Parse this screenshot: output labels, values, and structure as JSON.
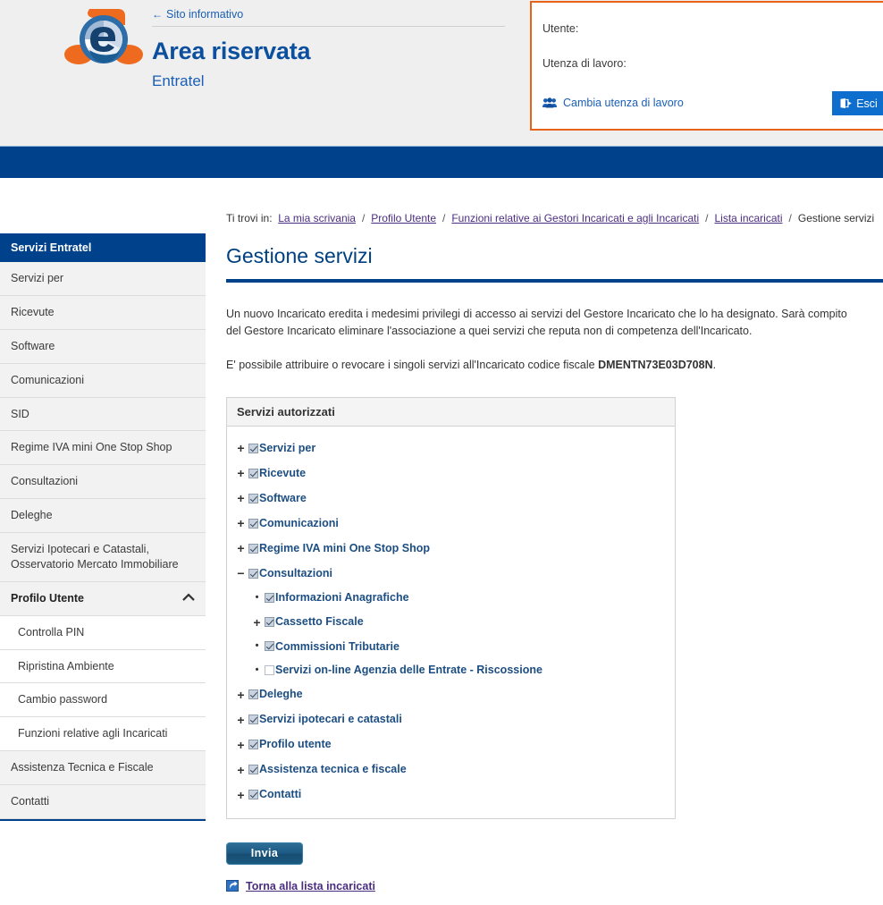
{
  "header": {
    "info_link": "Sito informativo",
    "back_arrow_icon": "arrow-left-icon",
    "title": "Area riservata",
    "subtitle": "Entratel",
    "logo_icon": "agenzia-entrate-logo"
  },
  "user_panel": {
    "user_label": "Utente:",
    "work_user_label": "Utenza di lavoro:",
    "change_user_link": "Cambia utenza di lavoro",
    "change_user_icon": "users-icon",
    "logout_label": "Esci",
    "logout_icon": "exit-icon",
    "border_color": "#e8631a"
  },
  "sidebar": {
    "heading": "Servizi Entratel",
    "collapse_icon": "chevron-up-icon",
    "items": [
      {
        "label": "Servizi per",
        "type": "item"
      },
      {
        "label": "Ricevute",
        "type": "item"
      },
      {
        "label": "Software",
        "type": "item"
      },
      {
        "label": "Comunicazioni",
        "type": "item"
      },
      {
        "label": "SID",
        "type": "item"
      },
      {
        "label": "Regime IVA mini One Stop Shop",
        "type": "item"
      },
      {
        "label": "Consultazioni",
        "type": "item"
      },
      {
        "label": "Deleghe",
        "type": "item"
      },
      {
        "label": "Servizi Ipotecari e Catastali, Osservatorio Mercato Immobiliare",
        "type": "item"
      },
      {
        "label": "Profilo Utente",
        "type": "group-open"
      },
      {
        "label": "Controlla PIN",
        "type": "sub"
      },
      {
        "label": "Ripristina Ambiente",
        "type": "sub"
      },
      {
        "label": "Cambio password",
        "type": "sub"
      },
      {
        "label": "Funzioni relative agli Incaricati",
        "type": "sub"
      },
      {
        "label": "Assistenza Tecnica e Fiscale",
        "type": "item"
      },
      {
        "label": "Contatti",
        "type": "item"
      }
    ]
  },
  "breadcrumb": {
    "prefix": "Ti trovi in:",
    "items": [
      {
        "label": "La mia scrivania",
        "link": true
      },
      {
        "label": "Profilo Utente",
        "link": true
      },
      {
        "label": "Funzioni relative ai Gestori Incaricati e agli Incaricati",
        "link": true
      },
      {
        "label": "Lista incaricati",
        "link": true
      },
      {
        "label": "Gestione servizi",
        "link": false
      }
    ],
    "separator": "/"
  },
  "main": {
    "title": "Gestione servizi",
    "paragraph1": "Un nuovo Incaricato eredita i medesimi privilegi di accesso ai servizi del Gestore Incaricato che lo ha designato. Sarà compito del Gestore Incaricato eliminare l'associazione a quei servizi che reputa non di competenza dell'Incaricato.",
    "paragraph2_pre": "E' possibile attribuire o revocare i singoli servizi all'Incaricato codice fiscale ",
    "paragraph2_code": "DMENTN73E03D708N",
    "paragraph2_post": ".",
    "panel_heading": "Servizi autorizzati",
    "submit_label": "Invia",
    "back_link": "Torna alla lista incaricati",
    "back_icon": "back-arrow-icon"
  },
  "tree": [
    {
      "level": 1,
      "marker": "+",
      "checked": true,
      "label": "Servizi per"
    },
    {
      "level": 1,
      "marker": "+",
      "checked": true,
      "label": "Ricevute"
    },
    {
      "level": 1,
      "marker": "+",
      "checked": true,
      "label": "Software"
    },
    {
      "level": 1,
      "marker": "+",
      "checked": true,
      "label": "Comunicazioni"
    },
    {
      "level": 1,
      "marker": "+",
      "checked": true,
      "label": "Regime IVA mini One Stop Shop"
    },
    {
      "level": 1,
      "marker": "−",
      "checked": true,
      "label": "Consultazioni"
    },
    {
      "level": 2,
      "marker": "•",
      "checked": true,
      "label": "Informazioni Anagrafiche"
    },
    {
      "level": 2,
      "marker": "+",
      "checked": true,
      "label": "Cassetto Fiscale"
    },
    {
      "level": 2,
      "marker": "•",
      "checked": true,
      "label": "Commissioni Tributarie"
    },
    {
      "level": 2,
      "marker": "•",
      "checked": false,
      "label": "Servizi on-line Agenzia delle Entrate - Riscossione"
    },
    {
      "level": 1,
      "marker": "+",
      "checked": true,
      "label": "Deleghe"
    },
    {
      "level": 1,
      "marker": "+",
      "checked": true,
      "label": "Servizi ipotecari e catastali"
    },
    {
      "level": 1,
      "marker": "+",
      "checked": true,
      "label": "Profilo utente"
    },
    {
      "level": 1,
      "marker": "+",
      "checked": true,
      "label": "Assistenza tecnica e fiscale"
    },
    {
      "level": 1,
      "marker": "+",
      "checked": true,
      "label": "Contatti"
    }
  ],
  "colors": {
    "brand_blue": "#00418b",
    "link_blue": "#1a5fb4",
    "tree_label": "#1d4e82",
    "accent_orange": "#e8631a",
    "breadcrumb_link": "#4b2d7f"
  }
}
